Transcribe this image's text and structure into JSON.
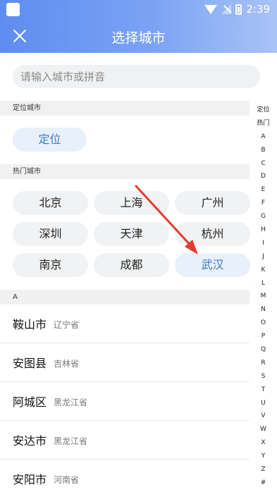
{
  "status_bar": {
    "time": "2:39"
  },
  "navbar": {
    "title": "选择城市",
    "close_icon": "close-icon"
  },
  "search": {
    "placeholder": "请输入城市或拼音",
    "value": ""
  },
  "location_section": {
    "header": "定位城市",
    "button": "定位"
  },
  "hot_section": {
    "header": "热门城市",
    "cities": [
      "北京",
      "上海",
      "广州",
      "深圳",
      "天津",
      "杭州",
      "南京",
      "成都",
      "武汉"
    ],
    "highlighted": "武汉"
  },
  "list_section": {
    "header": "A",
    "cities": [
      {
        "name": "鞍山市",
        "province": "辽宁省"
      },
      {
        "name": "安图县",
        "province": "吉林省"
      },
      {
        "name": "阿城区",
        "province": "黑龙江省"
      },
      {
        "name": "安达市",
        "province": "黑龙江省"
      },
      {
        "name": "安阳市",
        "province": "河南省"
      }
    ]
  },
  "index_bar": [
    "定位",
    "热门",
    "A",
    "B",
    "C",
    "D",
    "E",
    "F",
    "G",
    "H",
    "I",
    "J",
    "K",
    "L",
    "M",
    "N",
    "O",
    "P",
    "Q",
    "R",
    "S",
    "T",
    "U",
    "V",
    "W",
    "X",
    "Y",
    "Z",
    "#"
  ],
  "colors": {
    "accent": "#3a79c9",
    "header_gradient_start": "#5e8df0",
    "arrow": "#e53a2e"
  }
}
